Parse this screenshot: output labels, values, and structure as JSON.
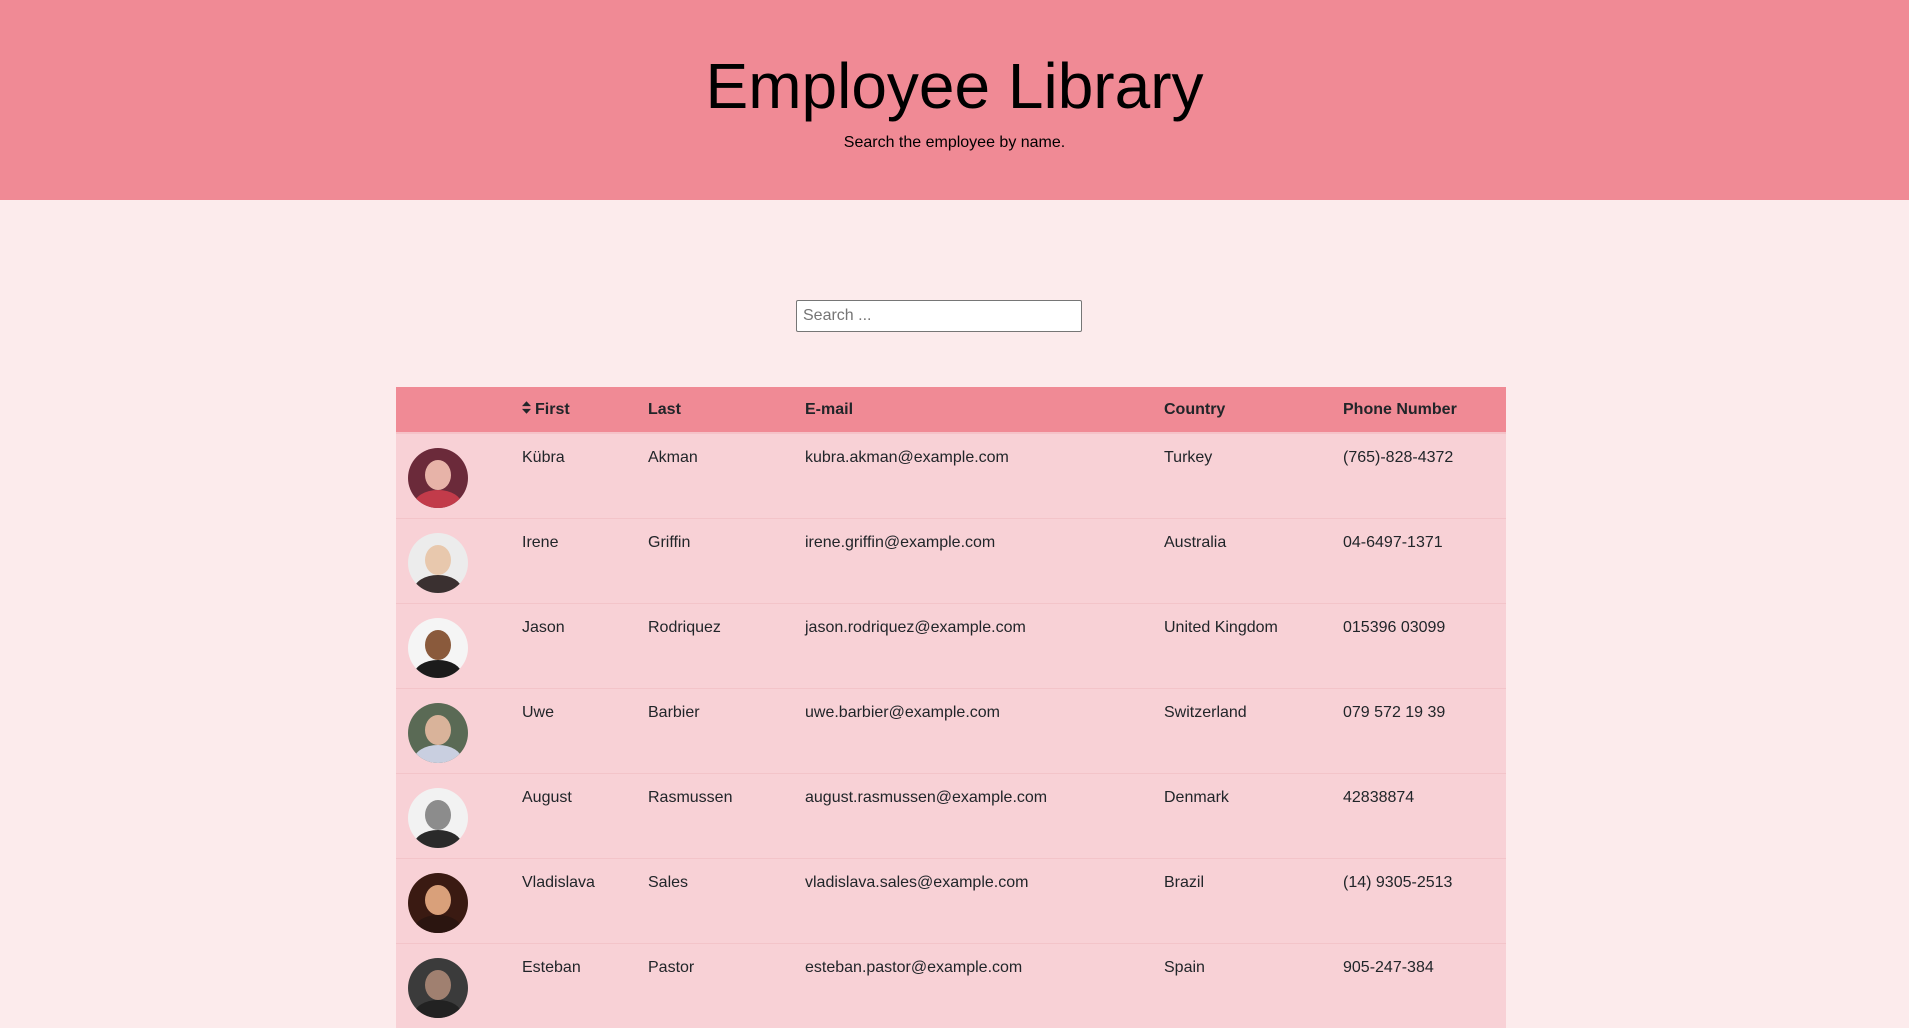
{
  "header": {
    "title": "Employee Library",
    "subtitle": "Search the employee by name."
  },
  "search": {
    "placeholder": "Search ...",
    "value": ""
  },
  "table": {
    "columns": [
      "",
      "First",
      "Last",
      "E-mail",
      "Country",
      "Phone Number"
    ],
    "rows": [
      {
        "first": "Kübra",
        "last": "Akman",
        "email": "kubra.akman@example.com",
        "country": "Turkey",
        "phone": "(765)-828-4372",
        "avatar": {
          "bg": "#6b2a3a",
          "face": "#e7b3a8",
          "body": "#c23b4a"
        }
      },
      {
        "first": "Irene",
        "last": "Griffin",
        "email": "irene.griffin@example.com",
        "country": "Australia",
        "phone": "04-6497-1371",
        "avatar": {
          "bg": "#ececec",
          "face": "#e8c8ad",
          "body": "#3a3030"
        }
      },
      {
        "first": "Jason",
        "last": "Rodriquez",
        "email": "jason.rodriquez@example.com",
        "country": "United Kingdom",
        "phone": "015396 03099",
        "avatar": {
          "bg": "#f5f5f5",
          "face": "#8a5a3c",
          "body": "#1b1b1b"
        }
      },
      {
        "first": "Uwe",
        "last": "Barbier",
        "email": "uwe.barbier@example.com",
        "country": "Switzerland",
        "phone": "079 572 19 39",
        "avatar": {
          "bg": "#5a6a55",
          "face": "#d9b39a",
          "body": "#c9cfe0"
        }
      },
      {
        "first": "August",
        "last": "Rasmussen",
        "email": "august.rasmussen@example.com",
        "country": "Denmark",
        "phone": "42838874",
        "avatar": {
          "bg": "#f2f2f2",
          "face": "#8c8c8c",
          "body": "#2a2a2a"
        }
      },
      {
        "first": "Vladislava",
        "last": "Sales",
        "email": "vladislava.sales@example.com",
        "country": "Brazil",
        "phone": "(14) 9305-2513",
        "avatar": {
          "bg": "#3a1a12",
          "face": "#d9a07a",
          "body": "#2b1510"
        }
      },
      {
        "first": "Esteban",
        "last": "Pastor",
        "email": "esteban.pastor@example.com",
        "country": "Spain",
        "phone": "905-247-384",
        "avatar": {
          "bg": "#3b3b3b",
          "face": "#a08070",
          "body": "#222222"
        }
      }
    ]
  },
  "colors": {
    "header_bg": "#f08a95",
    "page_bg": "#fcebec",
    "row_bg": "#f8d1d6"
  }
}
